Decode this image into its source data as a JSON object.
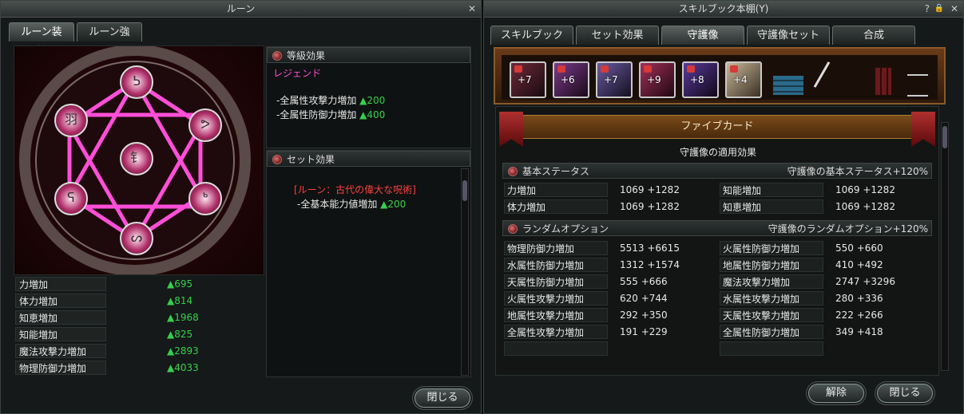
{
  "rune_window": {
    "title": "ルーン",
    "close_icon": "✕",
    "tabs": [
      {
        "label": "ルーン装着"
      },
      {
        "label": "ルーン強化"
      }
    ],
    "rune_glyphs": [
      "ᕊ",
      "羽",
      "ᕗ",
      "钅",
      "ᕋ",
      "ᒃ",
      "ᔕ"
    ],
    "grade_effect": {
      "header": "等級効果",
      "grade": "レジェンド",
      "lines": [
        {
          "label": "-全属性攻撃力増加",
          "value": "▲200"
        },
        {
          "label": "-全属性防御力増加",
          "value": "▲400"
        }
      ]
    },
    "set_effect": {
      "header": "セット効果",
      "name": "[ルーン：古代の偉大な呪術]",
      "line": {
        "label": "-全基本能力値増加",
        "value": "▲200"
      }
    },
    "stats": [
      {
        "label": "力増加",
        "value": "▲695"
      },
      {
        "label": "体力増加",
        "value": "▲814"
      },
      {
        "label": "知恵増加",
        "value": "▲1968"
      },
      {
        "label": "知能増加",
        "value": "▲825"
      },
      {
        "label": "魔法攻撃力増加",
        "value": "▲2893"
      },
      {
        "label": "物理防御力増加",
        "value": "▲4033"
      }
    ],
    "close_button": "閉じる",
    "colors": {
      "accent_pink": "#ff4fd8",
      "up_green": "#35d04b",
      "set_red": "#ff4040"
    }
  },
  "skillbook_window": {
    "title": "スキルブック本棚(Y)",
    "controls": {
      "help": "?",
      "lock": "🔒",
      "close": "✕"
    },
    "tabs": [
      {
        "label": "スキルブック"
      },
      {
        "label": "セット効果"
      },
      {
        "label": "守護像",
        "active": true
      },
      {
        "label": "守護像セット"
      },
      {
        "label": "合成"
      }
    ],
    "cards": [
      {
        "level": "+7",
        "locked": true,
        "color": "#6b2a3a"
      },
      {
        "level": "+6",
        "locked": true,
        "color": "#7a3a8a"
      },
      {
        "level": "+7",
        "locked": true,
        "color": "#6a5aa0"
      },
      {
        "level": "+9",
        "locked": true,
        "color": "#a0305a"
      },
      {
        "level": "+8",
        "locked": true,
        "color": "#5a3a9a"
      },
      {
        "level": "+4",
        "locked": true,
        "color": "#c8b89a"
      }
    ],
    "shelf_title": "ファイブカード",
    "effect_title": "守護像の適用効果",
    "basic_status": {
      "header": "基本ステータス",
      "bonus": "守護像の基本ステータス+120%",
      "rows": [
        [
          {
            "label": "力増加",
            "value": "1069 +1282"
          },
          {
            "label": "知能増加",
            "value": "1069 +1282"
          }
        ],
        [
          {
            "label": "体力増加",
            "value": "1069 +1282"
          },
          {
            "label": "知恵増加",
            "value": "1069 +1282"
          }
        ]
      ]
    },
    "random_option": {
      "header": "ランダムオプション",
      "bonus": "守護像のランダムオプション+120%",
      "rows": [
        [
          {
            "label": "物理防御力増加",
            "value": "5513 +6615"
          },
          {
            "label": "火属性防御力増加",
            "value": "550 +660"
          }
        ],
        [
          {
            "label": "水属性防御力増加",
            "value": "1312 +1574"
          },
          {
            "label": "地属性防御力増加",
            "value": "410 +492"
          }
        ],
        [
          {
            "label": "天属性防御力増加",
            "value": "555 +666"
          },
          {
            "label": "魔法攻撃力増加",
            "value": "2747 +3296"
          }
        ],
        [
          {
            "label": "火属性攻撃力増加",
            "value": "620 +744"
          },
          {
            "label": "水属性攻撃力増加",
            "value": "280 +336"
          }
        ],
        [
          {
            "label": "地属性攻撃力増加",
            "value": "292 +350"
          },
          {
            "label": "天属性攻撃力増加",
            "value": "222 +266"
          }
        ],
        [
          {
            "label": "全属性攻撃力増加",
            "value": "191 +229"
          },
          {
            "label": "全属性防御力増加",
            "value": "349 +418"
          }
        ],
        [
          {
            "label": "",
            "value": ""
          },
          {
            "label": "",
            "value": ""
          }
        ]
      ]
    },
    "release_button": "解除",
    "close_button": "閉じる"
  }
}
